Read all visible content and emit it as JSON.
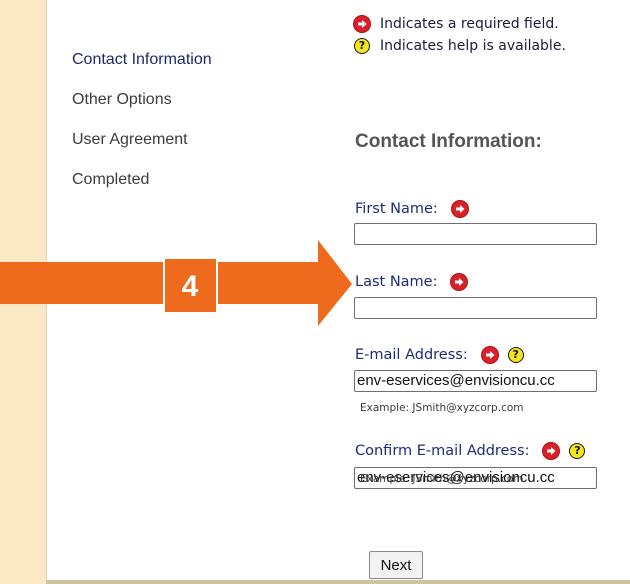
{
  "legend": {
    "required_text": "Indicates a required field.",
    "help_text": "Indicates help is available.",
    "required_icon": "required-arrow-icon",
    "help_icon": "help-question-icon"
  },
  "nav": {
    "items": [
      {
        "label": "Contact Information",
        "active": true
      },
      {
        "label": "Other Options",
        "active": false
      },
      {
        "label": "User Agreement",
        "active": false
      },
      {
        "label": "Completed",
        "active": false
      }
    ]
  },
  "form": {
    "title": "Contact Information:",
    "first_name": {
      "label": "First Name:",
      "value": ""
    },
    "last_name": {
      "label": "Last Name:",
      "value": ""
    },
    "email": {
      "label": "E-mail Address:",
      "value": "env-eservices@envisioncu.cc",
      "example": "Example: JSmith@xyzcorp.com"
    },
    "confirm_email": {
      "label": "Confirm E-mail Address:",
      "value": "env-eservices@envisioncu.cc",
      "example": "Example: JSmith@xyzcorp.com"
    },
    "next_label": "Next"
  },
  "annotation": {
    "step_number": "4",
    "arrow_color": "#ee6a1c"
  },
  "colors": {
    "background": "#fbe8c5",
    "required_red": "#d8222a",
    "help_yellow": "#f3e51f",
    "label_blue": "#1e2a78"
  }
}
